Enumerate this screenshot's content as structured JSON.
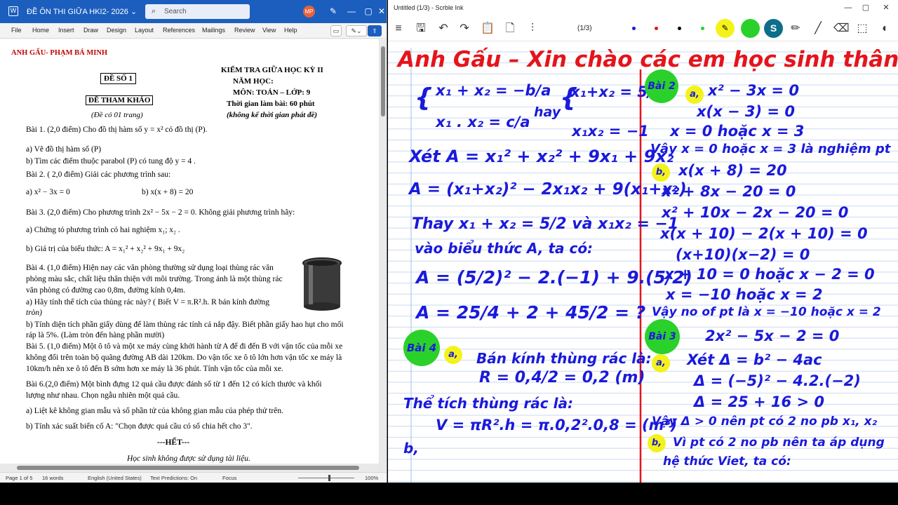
{
  "word": {
    "doc_title": "ĐỀ ÔN THI GIỮA HKI2- 2026 ⌄",
    "search_placeholder": "Search",
    "avatar": "MP",
    "menu": [
      "File",
      "Home",
      "Insert",
      "Draw",
      "Design",
      "Layout",
      "References",
      "Mailings",
      "Review",
      "View",
      "Help"
    ],
    "page": {
      "author": "ANH GẤU- PHẠM BÁ MINH",
      "de_so": "ĐỀ SỐ 1",
      "de_tham_khao": "ĐỀ THAM KHẢO",
      "de_co": "(Đề có 01 trang)",
      "exam_title": "KIỂM TRA GIỮA HỌC KỲ II",
      "nam_hoc": "NĂM HỌC:",
      "mon": "MÔN: TOÁN – LỚP: 9",
      "thoi_gian": "Thời gian làm bài: 60 phút",
      "khong_ke": "(không kể thời gian phát đề)",
      "lines": [
        "Bài 1. (2,0 điểm) Cho đồ thị hàm số  y = x²  có đồ thị (P).",
        "a) Vẽ đồ thị hàm số (P)",
        "b) Tìm các điểm thuộc parabol (P) có tung độ  y = 4 .",
        "Bài 2. ( 2,0 điểm) Giải các phương trình sau:",
        "a)  x² − 3x = 0",
        "b)  x(x + 8) = 20",
        "Bài 3. (2,0 điểm) Cho phương trình  2x² − 5x − 2 = 0. Không giải phương trình hãy:",
        "a) Chứng tỏ phương trình có hai nghiệm  x₁; x₂ .",
        "b) Giá trị của biểu thức:  A = x₁² + x₂² + 9x₁ + 9x₂",
        "Bài 4. (1,0 điểm) Hiện nay các văn phòng thường sử dụng loại thùng rác văn",
        "phòng màu sắc, chất liệu thân thiện với môi trường. Trong ảnh là một thùng rác",
        "văn phòng có đường cao 0,8m, đường kính 0,4m.",
        "a) Hãy tính thể tích của thùng rác này? ( Biết  V = π.R².h. R bán kính đường",
        "tròn)",
        "b) Tính diện tích phần giấy dùng để làm thùng rác tính cả nắp đậy. Biết phần giấy hao hụt cho mối",
        "ráp là 5%. (Làm tròn đến hàng phần mười)",
        "Bài 5. (1,0 điểm) Một ô tô và một xe máy cùng khởi hành từ A để đi đến B với vận tốc của mỗi xe",
        "không đổi trên toàn bộ quãng đường AB dài 120km. Do vận tốc xe ô tô lớn hơn vận tốc xe máy là",
        "10km/h nên xe ô tô đến B sớm hơn xe máy là 36 phút. Tính vận tốc của mỗi xe.",
        "Bài 6.(2,0 điểm) Một bình đựng 12 quả cầu được đánh số từ 1 đến 12 có kích thước và khối",
        "lượng như nhau. Chọn ngẫu nhiên một quả cầu.",
        "a) Liệt kê không gian mẫu và số phần tử của không gian mẫu của phép thử trên.",
        "b) Tính xác suất biến cố  A: \"Chọn được quả cầu có số chia hết cho 3\".",
        "---HẾT---",
        "Học sinh không được sử dụng tài liệu."
      ]
    },
    "status": {
      "page": "Page 1 of 5",
      "words": "16 words",
      "language": "English (United States)",
      "predictions": "Text Predictions: On",
      "focus": "Focus",
      "zoom": "100%"
    }
  },
  "ink": {
    "title": "Untitled (1/3) - Scrble Ink",
    "page_indicator": "(1/3)",
    "colors": {
      "blue": "#1a1adb",
      "red": "#e5141b",
      "green": "#2ad12a",
      "yellow": "#f3f31b"
    },
    "heading": "Anh Gấu – Xin chào các em học sinh thân yêu♡",
    "left_lines": [
      "x₁ + x₂ = −b/a",
      "x₁ . x₂ = c/a",
      "hay",
      "x₁+x₂ = 5/2",
      "x₁x₂ = −1",
      "Xét  A = x₁² + x₂² + 9x₁ + 9x₂",
      "A = (x₁+x₂)² − 2x₁x₂ + 9(x₁+x₂)",
      "Thay  x₁ + x₂ = 5/2  và x₁x₂ = −1",
      "vào biểu thức A, ta có:",
      "A = (5/2)² − 2.(−1) + 9.(5/2)",
      "A = 25/4 + 2 + 45/2 = ?",
      "Bán kính thùng rác là:",
      "R = 0,4/2 = 0,2 (m)",
      "Thể tích thùng rác là:",
      "V = πR².h = π.0,2².0,8 = (m³)",
      "b,"
    ],
    "right_lines": [
      "x² − 3x = 0",
      "x(x − 3) = 0",
      "x = 0  hoặc  x = 3",
      "Vậy  x = 0 hoặc  x = 3 là nghiệm pt",
      "x(x + 8) = 20",
      "x² + 8x − 20 = 0",
      "x² + 10x − 2x − 20 = 0",
      "x(x + 10) − 2(x + 10) = 0",
      "(x+10)(x−2) = 0",
      "x + 10 = 0  hoặc  x − 2 = 0",
      "x = −10  hoặc  x = 2",
      "Vậy no of pt là x = −10 hoặc x = 2",
      "2x² − 5x − 2 = 0",
      "Xét  Δ = b² − 4ac",
      "Δ = (−5)² − 4.2.(−2)",
      "Δ = 25 + 16 > 0",
      "Vậy Δ > 0 nên pt có 2 no pb x₁, x₂",
      "Vì pt có 2 no pb nên ta áp dụng",
      "hệ thức Viet, ta có:"
    ],
    "labels": {
      "bai2": "Bài 2",
      "bai3": "Bài 3",
      "bai4": "Bài 4",
      "a": "a,",
      "b": "b,"
    }
  }
}
